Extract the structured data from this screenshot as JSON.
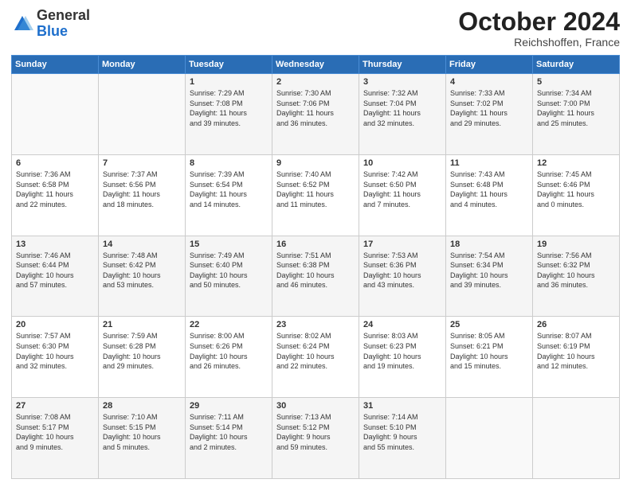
{
  "header": {
    "logo_general": "General",
    "logo_blue": "Blue",
    "month": "October 2024",
    "location": "Reichshoffen, France"
  },
  "weekdays": [
    "Sunday",
    "Monday",
    "Tuesday",
    "Wednesday",
    "Thursday",
    "Friday",
    "Saturday"
  ],
  "weeks": [
    [
      {
        "day": "",
        "info": ""
      },
      {
        "day": "",
        "info": ""
      },
      {
        "day": "1",
        "info": "Sunrise: 7:29 AM\nSunset: 7:08 PM\nDaylight: 11 hours\nand 39 minutes."
      },
      {
        "day": "2",
        "info": "Sunrise: 7:30 AM\nSunset: 7:06 PM\nDaylight: 11 hours\nand 36 minutes."
      },
      {
        "day": "3",
        "info": "Sunrise: 7:32 AM\nSunset: 7:04 PM\nDaylight: 11 hours\nand 32 minutes."
      },
      {
        "day": "4",
        "info": "Sunrise: 7:33 AM\nSunset: 7:02 PM\nDaylight: 11 hours\nand 29 minutes."
      },
      {
        "day": "5",
        "info": "Sunrise: 7:34 AM\nSunset: 7:00 PM\nDaylight: 11 hours\nand 25 minutes."
      }
    ],
    [
      {
        "day": "6",
        "info": "Sunrise: 7:36 AM\nSunset: 6:58 PM\nDaylight: 11 hours\nand 22 minutes."
      },
      {
        "day": "7",
        "info": "Sunrise: 7:37 AM\nSunset: 6:56 PM\nDaylight: 11 hours\nand 18 minutes."
      },
      {
        "day": "8",
        "info": "Sunrise: 7:39 AM\nSunset: 6:54 PM\nDaylight: 11 hours\nand 14 minutes."
      },
      {
        "day": "9",
        "info": "Sunrise: 7:40 AM\nSunset: 6:52 PM\nDaylight: 11 hours\nand 11 minutes."
      },
      {
        "day": "10",
        "info": "Sunrise: 7:42 AM\nSunset: 6:50 PM\nDaylight: 11 hours\nand 7 minutes."
      },
      {
        "day": "11",
        "info": "Sunrise: 7:43 AM\nSunset: 6:48 PM\nDaylight: 11 hours\nand 4 minutes."
      },
      {
        "day": "12",
        "info": "Sunrise: 7:45 AM\nSunset: 6:46 PM\nDaylight: 11 hours\nand 0 minutes."
      }
    ],
    [
      {
        "day": "13",
        "info": "Sunrise: 7:46 AM\nSunset: 6:44 PM\nDaylight: 10 hours\nand 57 minutes."
      },
      {
        "day": "14",
        "info": "Sunrise: 7:48 AM\nSunset: 6:42 PM\nDaylight: 10 hours\nand 53 minutes."
      },
      {
        "day": "15",
        "info": "Sunrise: 7:49 AM\nSunset: 6:40 PM\nDaylight: 10 hours\nand 50 minutes."
      },
      {
        "day": "16",
        "info": "Sunrise: 7:51 AM\nSunset: 6:38 PM\nDaylight: 10 hours\nand 46 minutes."
      },
      {
        "day": "17",
        "info": "Sunrise: 7:53 AM\nSunset: 6:36 PM\nDaylight: 10 hours\nand 43 minutes."
      },
      {
        "day": "18",
        "info": "Sunrise: 7:54 AM\nSunset: 6:34 PM\nDaylight: 10 hours\nand 39 minutes."
      },
      {
        "day": "19",
        "info": "Sunrise: 7:56 AM\nSunset: 6:32 PM\nDaylight: 10 hours\nand 36 minutes."
      }
    ],
    [
      {
        "day": "20",
        "info": "Sunrise: 7:57 AM\nSunset: 6:30 PM\nDaylight: 10 hours\nand 32 minutes."
      },
      {
        "day": "21",
        "info": "Sunrise: 7:59 AM\nSunset: 6:28 PM\nDaylight: 10 hours\nand 29 minutes."
      },
      {
        "day": "22",
        "info": "Sunrise: 8:00 AM\nSunset: 6:26 PM\nDaylight: 10 hours\nand 26 minutes."
      },
      {
        "day": "23",
        "info": "Sunrise: 8:02 AM\nSunset: 6:24 PM\nDaylight: 10 hours\nand 22 minutes."
      },
      {
        "day": "24",
        "info": "Sunrise: 8:03 AM\nSunset: 6:23 PM\nDaylight: 10 hours\nand 19 minutes."
      },
      {
        "day": "25",
        "info": "Sunrise: 8:05 AM\nSunset: 6:21 PM\nDaylight: 10 hours\nand 15 minutes."
      },
      {
        "day": "26",
        "info": "Sunrise: 8:07 AM\nSunset: 6:19 PM\nDaylight: 10 hours\nand 12 minutes."
      }
    ],
    [
      {
        "day": "27",
        "info": "Sunrise: 7:08 AM\nSunset: 5:17 PM\nDaylight: 10 hours\nand 9 minutes."
      },
      {
        "day": "28",
        "info": "Sunrise: 7:10 AM\nSunset: 5:15 PM\nDaylight: 10 hours\nand 5 minutes."
      },
      {
        "day": "29",
        "info": "Sunrise: 7:11 AM\nSunset: 5:14 PM\nDaylight: 10 hours\nand 2 minutes."
      },
      {
        "day": "30",
        "info": "Sunrise: 7:13 AM\nSunset: 5:12 PM\nDaylight: 9 hours\nand 59 minutes."
      },
      {
        "day": "31",
        "info": "Sunrise: 7:14 AM\nSunset: 5:10 PM\nDaylight: 9 hours\nand 55 minutes."
      },
      {
        "day": "",
        "info": ""
      },
      {
        "day": "",
        "info": ""
      }
    ]
  ]
}
